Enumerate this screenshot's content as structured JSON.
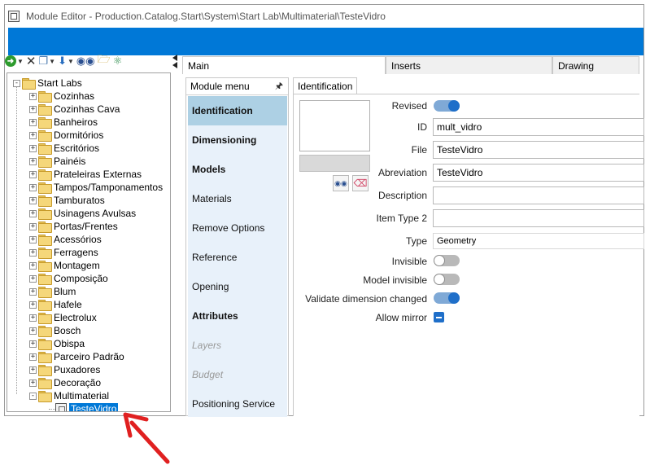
{
  "window": {
    "title": "Module Editor - Production.Catalog.Start\\System\\Start Lab\\Multimaterial\\TesteVidro"
  },
  "toolbar": {
    "icons": [
      "go-icon",
      "delete-icon",
      "copy-icon",
      "move-down-icon",
      "binoculars-icon",
      "folder-search-icon",
      "network-icon"
    ]
  },
  "tree": {
    "root": "Start Labs",
    "items": [
      "Cozinhas",
      "Cozinhas Cava",
      "Banheiros",
      "Dormitórios",
      "Escritórios",
      "Painéis",
      "Prateleiras Externas",
      "Tampos/Tamponamentos",
      "Tamburatos",
      "Usinagens Avulsas",
      "Portas/Frentes",
      "Acessórios",
      "Ferragens",
      "Montagem",
      "Composição",
      "Blum",
      "Hafele",
      "Electrolux",
      "Bosch",
      "Obispa",
      "Parceiro Padrão",
      "Puxadores",
      "Decoração",
      "Multimaterial"
    ],
    "selected": "TesteVidro"
  },
  "tabs": {
    "main": "Main",
    "inserts": "Inserts",
    "drawing": "Drawing"
  },
  "menu": {
    "header": "Module menu",
    "items": [
      {
        "label": "Identification"
      },
      {
        "label": "Dimensioning"
      },
      {
        "label": "Models"
      },
      {
        "label": "Materials"
      },
      {
        "label": "Remove Options"
      },
      {
        "label": "Reference"
      },
      {
        "label": "Opening"
      },
      {
        "label": "Attributes"
      },
      {
        "label": "Layers"
      },
      {
        "label": "Budget"
      },
      {
        "label": "Positioning Service"
      }
    ]
  },
  "identification": {
    "tab_label": "Identification",
    "revised_label": "Revised",
    "revised": true,
    "id_label": "ID",
    "id_value": "mult_vidro",
    "file_label": "File",
    "file_value": "TesteVidro",
    "abreviation_label": "Abreviation",
    "abreviation_value": "TesteVidro",
    "description_label": "Description",
    "description_value": "",
    "item_type2_label": "Item Type 2",
    "item_type2_value": "",
    "type_label": "Type",
    "type_value": "Geometry",
    "invisible_label": "Invisible",
    "invisible": false,
    "model_invisible_label": "Model invisible",
    "model_invisible": false,
    "validate_label": "Validate dimension changed",
    "validate": true,
    "allow_mirror_label": "Allow mirror",
    "allow_mirror": true
  },
  "colors": {
    "accent": "#0078d7",
    "menu_bg": "#e8f1fa",
    "menu_active": "#add0e4",
    "annotation_arrow": "#e02020"
  }
}
